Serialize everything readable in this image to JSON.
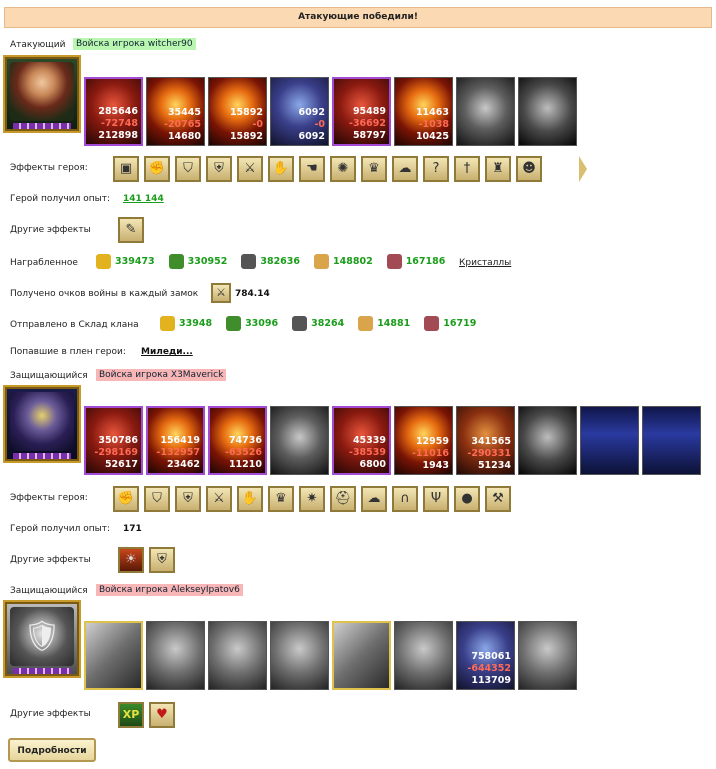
{
  "banner": "Атакующие победили!",
  "attacker": {
    "role": "Атакующий",
    "troops": "Войска игрока witcher90",
    "units": [
      {
        "art": "u-red",
        "border": "purple",
        "alive": "285646",
        "lost": "-72748",
        "remain": "212898"
      },
      {
        "art": "u-fire",
        "border": "none",
        "alive": "35445",
        "lost": "-20765",
        "remain": "14680"
      },
      {
        "art": "u-fire",
        "border": "none",
        "alive": "15892",
        "lost": "-0",
        "remain": "15892"
      },
      {
        "art": "u-blue",
        "border": "none",
        "alive": "6092",
        "lost": "-0",
        "remain": "6092"
      },
      {
        "art": "u-red",
        "border": "purple",
        "alive": "95489",
        "lost": "-36692",
        "remain": "58797"
      },
      {
        "art": "u-fire",
        "border": "none",
        "alive": "11463",
        "lost": "-1038",
        "remain": "10425"
      },
      {
        "art": "u-grey",
        "border": "none",
        "alive": "",
        "lost": "",
        "remain": ""
      },
      {
        "art": "u-ghost",
        "border": "none",
        "alive": "",
        "lost": "",
        "remain": ""
      }
    ],
    "effects_label": "Эффекты героя:",
    "effects": [
      "chest-icon",
      "fist-icon",
      "shield-icon",
      "shield-red-icon",
      "sword-icon",
      "handshake-icon",
      "hand-icon",
      "sigil-icon",
      "crown-icon",
      "ghost-icon",
      "question-icon",
      "blade-icon",
      "tower-icon",
      "mask-icon"
    ],
    "exp_label": "Герой получил опыт:",
    "exp_value": "141 144",
    "other_label": "Другие эффекты",
    "plunder_label": "Награбленное",
    "plunder": [
      {
        "icon": "gold-icon",
        "color": "#e3b21f",
        "value": "339473"
      },
      {
        "icon": "tree-icon",
        "color": "#3f8e2b",
        "value": "330952"
      },
      {
        "icon": "ore-icon",
        "color": "#555555",
        "value": "382636"
      },
      {
        "icon": "wheat-icon",
        "color": "#d9a44a",
        "value": "148802"
      },
      {
        "icon": "crystal-icon",
        "color": "#a34b54",
        "value": "167186"
      }
    ],
    "crystals_link": "Кристаллы",
    "war_label": "Получено очков войны в каждый замок",
    "war_value": "784.14",
    "clan_label": "Отправлено в Склад клана",
    "clan": [
      {
        "icon": "gold-icon",
        "color": "#e3b21f",
        "value": "33948"
      },
      {
        "icon": "tree-icon",
        "color": "#3f8e2b",
        "value": "33096"
      },
      {
        "icon": "ore-icon",
        "color": "#555555",
        "value": "38264"
      },
      {
        "icon": "wheat-icon",
        "color": "#d9a44a",
        "value": "14881"
      },
      {
        "icon": "crystal-icon",
        "color": "#a34b54",
        "value": "16719"
      }
    ],
    "captured_label": "Попавшие в плен герои:",
    "captured_value": "Миледи..."
  },
  "defender1": {
    "role": "Защищающийся",
    "troops": "Войска игрока X3Maverick",
    "units": [
      {
        "art": "u-red",
        "border": "purple",
        "alive": "350786",
        "lost": "-298169",
        "remain": "52617"
      },
      {
        "art": "u-fire",
        "border": "purple",
        "alive": "156419",
        "lost": "-132957",
        "remain": "23462"
      },
      {
        "art": "u-fire",
        "border": "purple",
        "alive": "74736",
        "lost": "-63526",
        "remain": "11210"
      },
      {
        "art": "u-grey",
        "border": "none",
        "alive": "",
        "lost": "",
        "remain": ""
      },
      {
        "art": "u-red",
        "border": "purple",
        "alive": "45339",
        "lost": "-38539",
        "remain": "6800"
      },
      {
        "art": "u-fire",
        "border": "none",
        "alive": "12959",
        "lost": "-11016",
        "remain": "1943"
      },
      {
        "art": "u-orc",
        "border": "none",
        "alive": "341565",
        "lost": "-290331",
        "remain": "51234"
      },
      {
        "art": "u-ghost",
        "border": "none",
        "alive": "",
        "lost": "",
        "remain": ""
      },
      {
        "art": "u-tower",
        "border": "none",
        "alive": "",
        "lost": "",
        "remain": ""
      },
      {
        "art": "u-tower",
        "border": "none",
        "alive": "",
        "lost": "",
        "remain": ""
      }
    ],
    "effects_label": "Эффекты героя:",
    "effects": [
      "fist-icon",
      "shield-icon",
      "shield-red-icon",
      "sword-icon",
      "handshake-icon",
      "crown-icon",
      "web-icon",
      "helm-icon",
      "ghost-icon",
      "horseshoe-icon",
      "trident-icon",
      "orb-icon",
      "axe-icon"
    ],
    "exp_label": "Герой получил опыт:",
    "exp_value": "171",
    "other_label": "Другие эффекты"
  },
  "defender2": {
    "role": "Защищающийся",
    "troops": "Войска игрока AlekseyIpatov6",
    "units": [
      {
        "art": "u-sw",
        "border": "gold",
        "alive": "",
        "lost": "",
        "remain": ""
      },
      {
        "art": "u-kn",
        "border": "none",
        "alive": "",
        "lost": "",
        "remain": ""
      },
      {
        "art": "u-kn",
        "border": "none",
        "alive": "",
        "lost": "",
        "remain": ""
      },
      {
        "art": "u-kn",
        "border": "none",
        "alive": "",
        "lost": "",
        "remain": ""
      },
      {
        "art": "u-sw",
        "border": "gold",
        "alive": "",
        "lost": "",
        "remain": ""
      },
      {
        "art": "u-kn",
        "border": "none",
        "alive": "",
        "lost": "",
        "remain": ""
      },
      {
        "art": "u-blue",
        "border": "none",
        "alive": "758061",
        "lost": "-644352",
        "remain": "113709"
      },
      {
        "art": "u-kn",
        "border": "none",
        "alive": "",
        "lost": "",
        "remain": ""
      }
    ],
    "other_label": "Другие эффекты"
  },
  "details_button": "Подробности"
}
